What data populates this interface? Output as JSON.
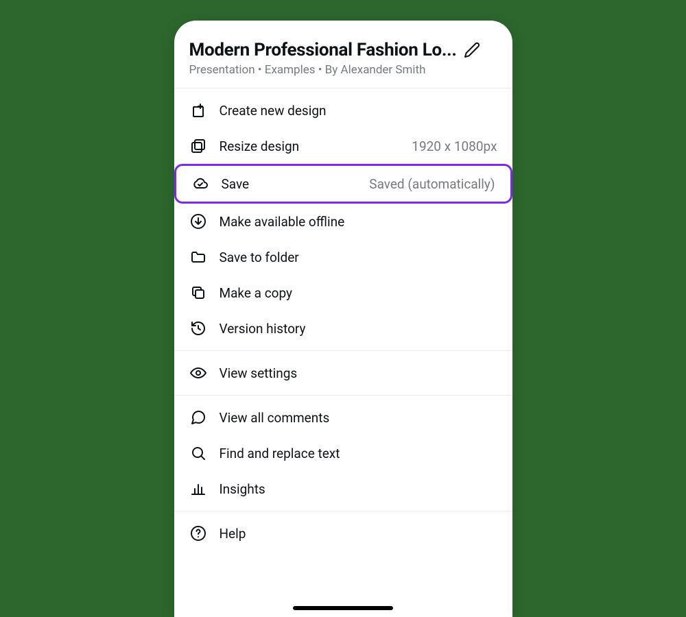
{
  "header": {
    "title": "Modern Professional Fashion Lo...",
    "subtitle": "Presentation • Examples • By Alexander Smith"
  },
  "sections": [
    {
      "items": [
        {
          "key": "create",
          "label": "Create new design"
        },
        {
          "key": "resize",
          "label": "Resize design",
          "trailing": "1920 x 1080px"
        },
        {
          "key": "save",
          "label": "Save",
          "trailing": "Saved (automatically)",
          "highlighted": true
        },
        {
          "key": "offline",
          "label": "Make available offline"
        },
        {
          "key": "folder",
          "label": "Save to folder"
        },
        {
          "key": "copy",
          "label": "Make a copy"
        },
        {
          "key": "version",
          "label": "Version history"
        }
      ]
    },
    {
      "items": [
        {
          "key": "viewsettings",
          "label": "View settings"
        }
      ]
    },
    {
      "items": [
        {
          "key": "comments",
          "label": "View all comments"
        },
        {
          "key": "find",
          "label": "Find and replace text"
        },
        {
          "key": "insights",
          "label": "Insights"
        }
      ]
    },
    {
      "items": [
        {
          "key": "help",
          "label": "Help"
        }
      ]
    }
  ]
}
